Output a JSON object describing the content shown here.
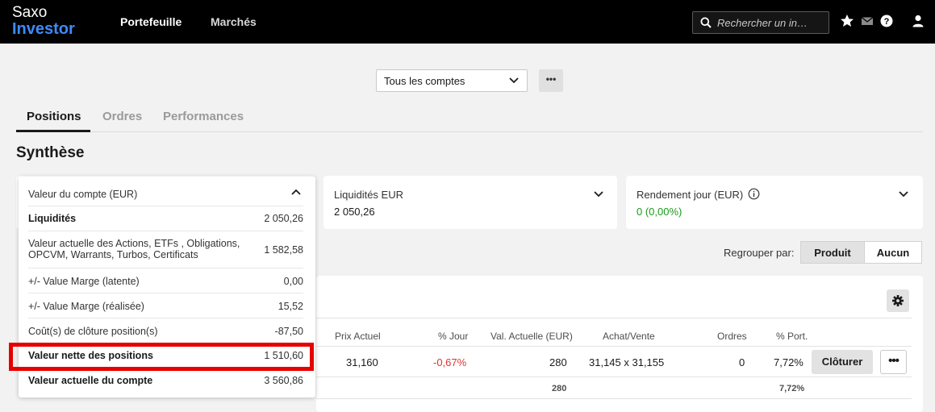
{
  "brand": {
    "line1": "Saxo",
    "line2": "Investor"
  },
  "nav": {
    "portfolio": "Portefeuille",
    "markets": "Marchés"
  },
  "search": {
    "placeholder": "Rechercher un in…"
  },
  "icons": [
    "search-icon",
    "star-icon",
    "mail-icon",
    "help-icon",
    "user-icon",
    "chevron-down-icon",
    "chevron-up-icon",
    "info-icon",
    "gear-icon"
  ],
  "colors": {
    "brand_blue": "#3d8bff",
    "positive": "#1a9a1a",
    "negative": "#e03030",
    "highlight": "#e60000"
  },
  "account_select": {
    "value": "Tous les comptes",
    "more": "•••"
  },
  "tabs": [
    "Positions",
    "Ordres",
    "Performances"
  ],
  "section_title": "Synthèse",
  "cards": {
    "liquidity": {
      "title": "Liquidités EUR",
      "value": "2 050,26"
    },
    "daily_return": {
      "title": "Rendement jour (EUR)",
      "value": "0 (0,00%)"
    }
  },
  "account_value_panel": {
    "title": "Valeur du compte (EUR)",
    "rows": [
      {
        "label": "Liquidités",
        "value": "2 050,26",
        "bold": true
      },
      {
        "label": "Valeur actuelle des Actions, ETFs , Obligations, OPCVM, Warrants, Turbos, Certificats",
        "value": "1 582,58",
        "bold": false
      },
      {
        "label": "+/- Value Marge (latente)",
        "value": "0,00",
        "bold": false
      },
      {
        "label": "+/- Value Marge (réalisée)",
        "value": "15,52",
        "bold": false
      },
      {
        "label": "Coût(s) de clôture position(s)",
        "value": "-87,50",
        "bold": false
      },
      {
        "label": "Valeur nette des positions",
        "value": "1 510,60",
        "bold": true
      },
      {
        "label": "Valeur actuelle du compte",
        "value": "3 560,86",
        "bold": true
      }
    ]
  },
  "group_by": {
    "label": "Regrouper par:",
    "options": [
      "Produit",
      "Aucun"
    ],
    "selected": "Produit"
  },
  "positions_table": {
    "columns": [
      "Prix Actuel",
      "% Jour",
      "Val. Actuelle (EUR)",
      "Achat/Vente",
      "Ordres",
      "% Port."
    ],
    "rows": [
      {
        "price": "31,160",
        "day_pct": "-0,67%",
        "value": "280",
        "bid_ask": "31,145 x 31,155",
        "orders": "0",
        "port_pct": "7,72%"
      }
    ],
    "totals": {
      "value": "280",
      "port_pct": "7,72%"
    },
    "close_label": "Clôturer",
    "more_label": "•••"
  }
}
